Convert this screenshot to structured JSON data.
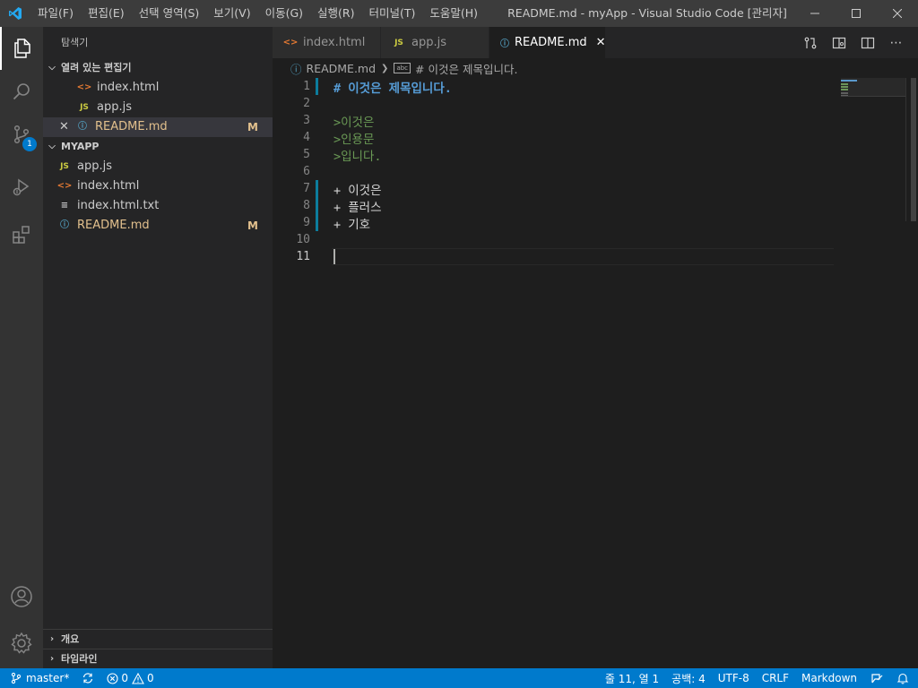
{
  "window": {
    "title": "README.md - myApp - Visual Studio Code [관리자]"
  },
  "menu": [
    "파일(F)",
    "편집(E)",
    "선택 영역(S)",
    "보기(V)",
    "이동(G)",
    "실행(R)",
    "터미널(T)",
    "도움말(H)"
  ],
  "activity_bar": {
    "scm_badge": "1"
  },
  "sidebar": {
    "title": "탐색기",
    "open_editors": {
      "header": "열려 있는 편집기",
      "items": [
        {
          "name": "index.html",
          "icon": "html-icon"
        },
        {
          "name": "app.js",
          "icon": "js-icon"
        },
        {
          "name": "README.md",
          "icon": "info-icon",
          "status": "M"
        }
      ]
    },
    "project": {
      "header": "MYAPP",
      "items": [
        {
          "name": "app.js",
          "icon": "js-icon"
        },
        {
          "name": "index.html",
          "icon": "html-icon"
        },
        {
          "name": "index.html.txt",
          "icon": "text-file-icon"
        },
        {
          "name": "README.md",
          "icon": "info-icon",
          "status": "M"
        }
      ]
    },
    "outline_header": "개요",
    "timeline_header": "타임라인"
  },
  "tabs": [
    {
      "label": "index.html",
      "icon": "html-icon"
    },
    {
      "label": "app.js",
      "icon": "js-icon"
    },
    {
      "label": "README.md",
      "icon": "info-icon"
    }
  ],
  "breadcrumb": {
    "file": "README.md",
    "symbol": "# 이것은 제목입니다."
  },
  "editor": {
    "lines": [
      {
        "num": "1",
        "text": "# 이것은 제목입니다."
      },
      {
        "num": "2",
        "text": ""
      },
      {
        "num": "3",
        "text": ">이것은"
      },
      {
        "num": "4",
        "text": ">인용문"
      },
      {
        "num": "5",
        "text": ">입니다."
      },
      {
        "num": "6",
        "text": ""
      },
      {
        "num": "7",
        "text": "+ 이것은"
      },
      {
        "num": "8",
        "text": "+ 플러스"
      },
      {
        "num": "9",
        "text": "+ 기호"
      },
      {
        "num": "10",
        "text": ""
      },
      {
        "num": "11",
        "text": ""
      }
    ]
  },
  "statusbar": {
    "branch": "master*",
    "errors": "0",
    "warnings": "0",
    "cursor_position": "줄 11, 열 1",
    "indent": "공백: 4",
    "encoding": "UTF-8",
    "eol": "CRLF",
    "language": "Markdown"
  },
  "colors": {
    "accent": "#007acc",
    "modified": "#e2c08d",
    "heading": "#569cd6",
    "quote": "#6a9955"
  }
}
